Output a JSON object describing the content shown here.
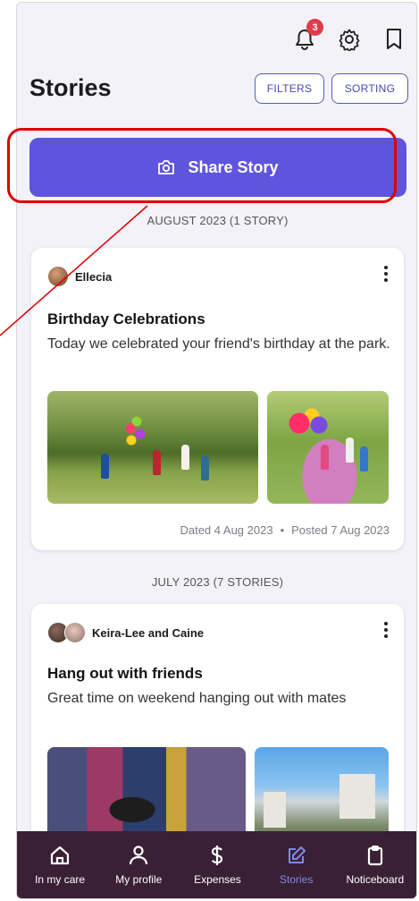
{
  "header": {
    "title": "Stories",
    "notification_count": "3",
    "filters_label": "FILTERS",
    "sorting_label": "SORTING"
  },
  "share_button_label": "Share Story",
  "sections": [
    {
      "heading": "AUGUST 2023 (1 STORY)",
      "story": {
        "author": "Ellecia",
        "title": "Birthday Celebrations",
        "text": "Today we celebrated your friend's birthday at the park.",
        "dated": "Dated 4 Aug 2023",
        "separator": "•",
        "posted": "Posted 7 Aug 2023"
      }
    },
    {
      "heading": "JULY 2023 (7 STORIES)",
      "story": {
        "author": "Keira-Lee and Caine",
        "title": "Hang out with friends",
        "text": "Great time on weekend hanging out with mates"
      }
    }
  ],
  "bottom_nav": [
    {
      "label": "In my care",
      "icon": "home-icon"
    },
    {
      "label": "My profile",
      "icon": "person-icon"
    },
    {
      "label": "Expenses",
      "icon": "dollar-icon"
    },
    {
      "label": "Stories",
      "icon": "edit-icon",
      "active": true
    },
    {
      "label": "Noticeboard",
      "icon": "clipboard-icon"
    }
  ],
  "colors": {
    "accent": "#5f55dd",
    "nav_bg": "#3a1f35",
    "active_nav": "#7d8ae6",
    "badge": "#e23b4a",
    "annotation": "#e00000"
  }
}
